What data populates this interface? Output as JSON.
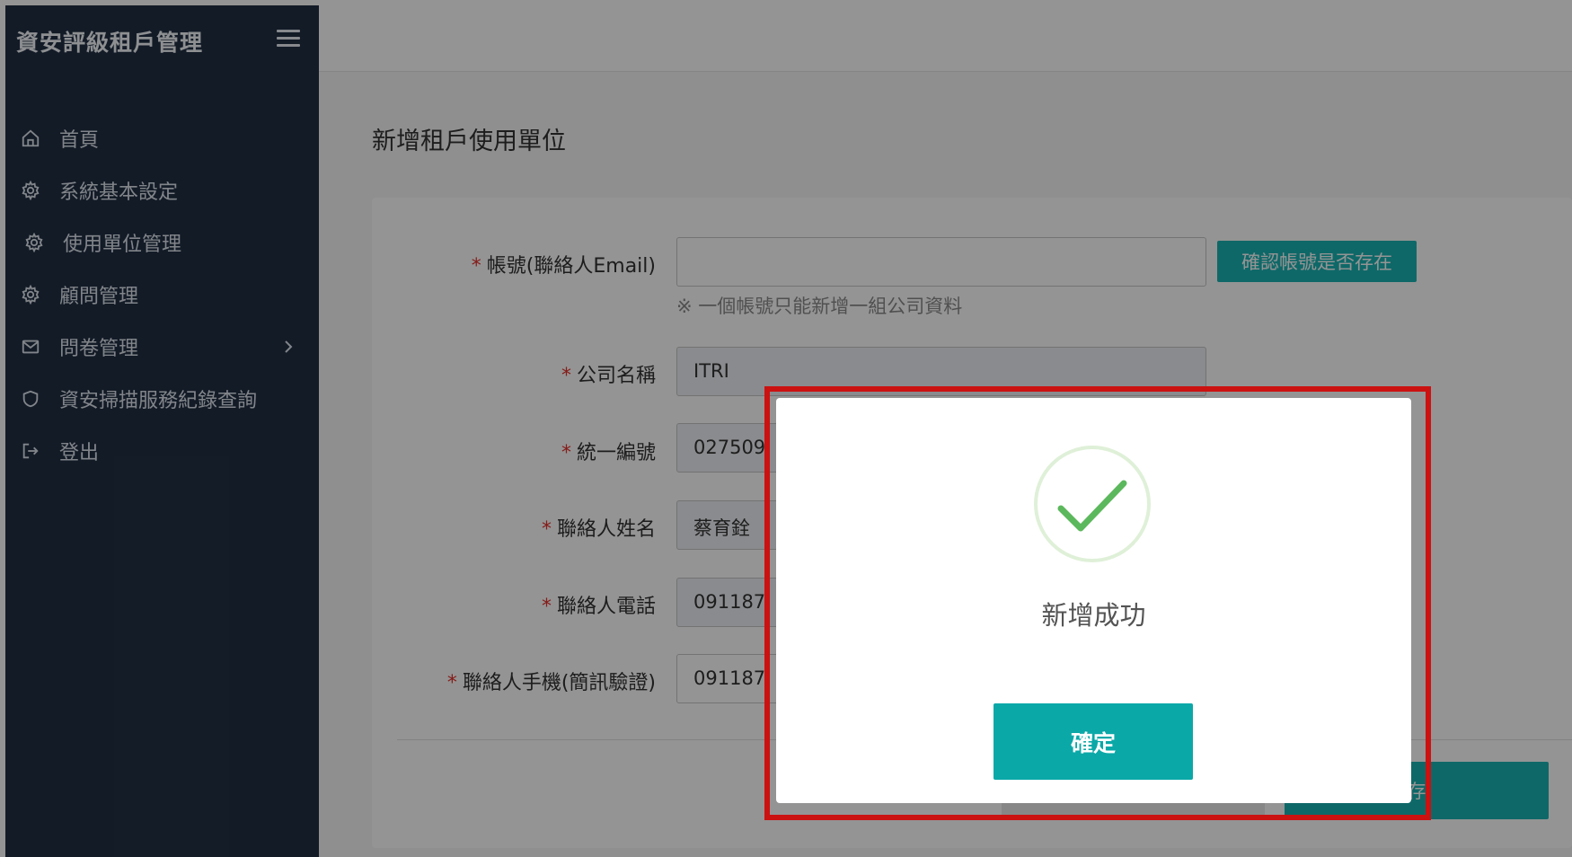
{
  "app": {
    "title": "資安評級租戶管理"
  },
  "sidebar": {
    "items": [
      {
        "label": "首頁",
        "icon": "home-icon"
      },
      {
        "label": "系統基本設定",
        "icon": "gear-icon"
      },
      {
        "label": "使用單位管理",
        "icon": "gear-icon"
      },
      {
        "label": "顧問管理",
        "icon": "gear-icon"
      },
      {
        "label": "問卷管理",
        "icon": "mail-icon"
      },
      {
        "label": "資安掃描服務紀錄查詢",
        "icon": "shield-icon"
      },
      {
        "label": "登出",
        "icon": "logout-icon"
      }
    ]
  },
  "page": {
    "title": "新增租戶使用單位"
  },
  "form": {
    "required_mark": "*",
    "account_label": "帳號(聯絡人Email)",
    "account_value": "",
    "check_button": "確認帳號是否存在",
    "hint": "※ 一個帳號只能新增一組公司資料",
    "company_label": "公司名稱",
    "company_value": "ITRI",
    "tax_label": "統一編號",
    "tax_value": "027509",
    "contact_name_label": "聯絡人姓名",
    "contact_name_value": "蔡育銓",
    "contact_phone_label": "聯絡人電話",
    "contact_phone_value": "091187",
    "mobile_label": "聯絡人手機(簡訊驗證)",
    "mobile_value": "091187",
    "save_button": "存"
  },
  "dialog": {
    "title": "新增成功",
    "ok_button": "確定",
    "icon": "success-check-icon"
  },
  "colors": {
    "sidebar": "#223044",
    "accent": "#1ab3b3",
    "highlight": "#cc1111",
    "success": "#5cb85c"
  }
}
